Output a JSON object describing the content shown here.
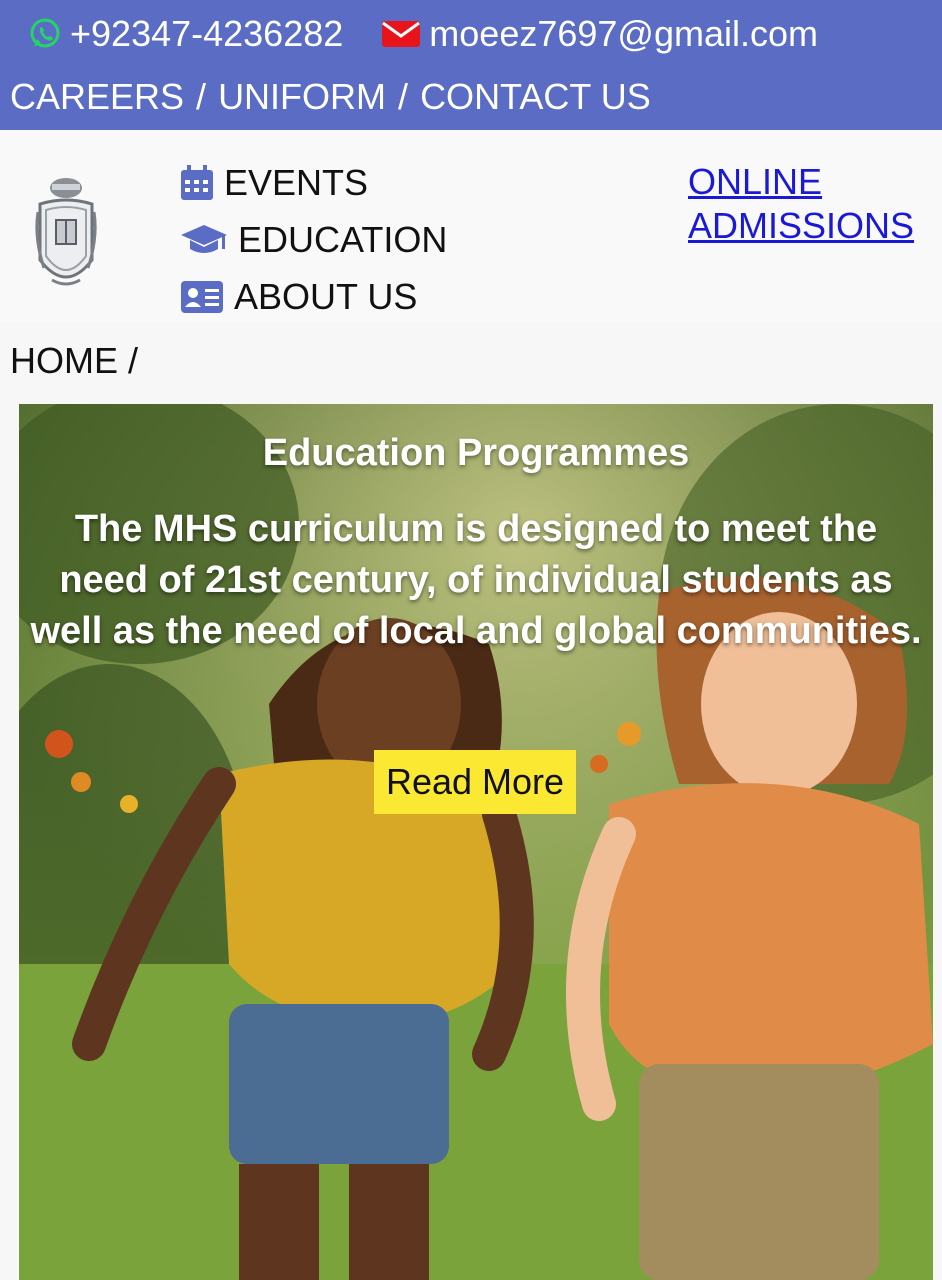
{
  "topbar": {
    "phone": "+92347-4236282",
    "email": "moeez7697@gmail.com",
    "links": [
      "CAREERS",
      "UNIFORM",
      "CONTACT US"
    ],
    "separator": "/",
    "icons": [
      "whatsapp-icon",
      "mail-icon"
    ],
    "background": "#5b6cc4"
  },
  "nav": {
    "items": [
      {
        "label": "EVENTS",
        "icon": "calendar-icon"
      },
      {
        "label": "EDUCATION",
        "icon": "graduation-cap-icon"
      },
      {
        "label": "ABOUT US",
        "icon": "id-card-icon"
      }
    ],
    "online_line1": "ONLINE",
    "online_line2": "ADMISSIONS",
    "icon_color": "#5b6cc4"
  },
  "breadcrumb": {
    "text": "HOME /"
  },
  "hero": {
    "title": "Education Programmes",
    "text": "The MHS curriculum is designed to meet the need of 21st century, of individual students as well as the need of local and global communities.",
    "button_label": "Read More",
    "button_color": "#fbe832"
  }
}
